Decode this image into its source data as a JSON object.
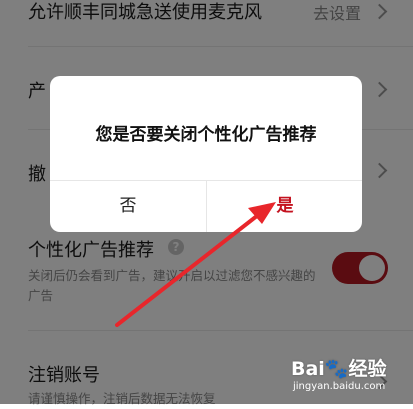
{
  "settings": {
    "row1": {
      "title": "允许顺丰同城急送使用麦克风",
      "value": "去设置"
    },
    "row2": {
      "title_partial": "产"
    },
    "row3": {
      "title_partial": "撤"
    },
    "personalized_ads": {
      "title": "个性化广告推荐",
      "help_symbol": "?",
      "description": "关闭后仍会看到广告，建议开启以过滤您不感兴趣的广告",
      "enabled": true,
      "toggle_color": "#b51822"
    },
    "cancel_account": {
      "title": "注销账号",
      "description": "请谨慎操作，注销后数据无法恢复"
    }
  },
  "dialog": {
    "title": "您是否要关闭个性化广告推荐",
    "no_label": "否",
    "yes_label": "是",
    "yes_color": "#c4121f"
  },
  "annotation": {
    "arrow_color": "#e8262b"
  },
  "watermark": {
    "logo": "Bai🐾经验",
    "url": "jingyan.baidu.com"
  }
}
